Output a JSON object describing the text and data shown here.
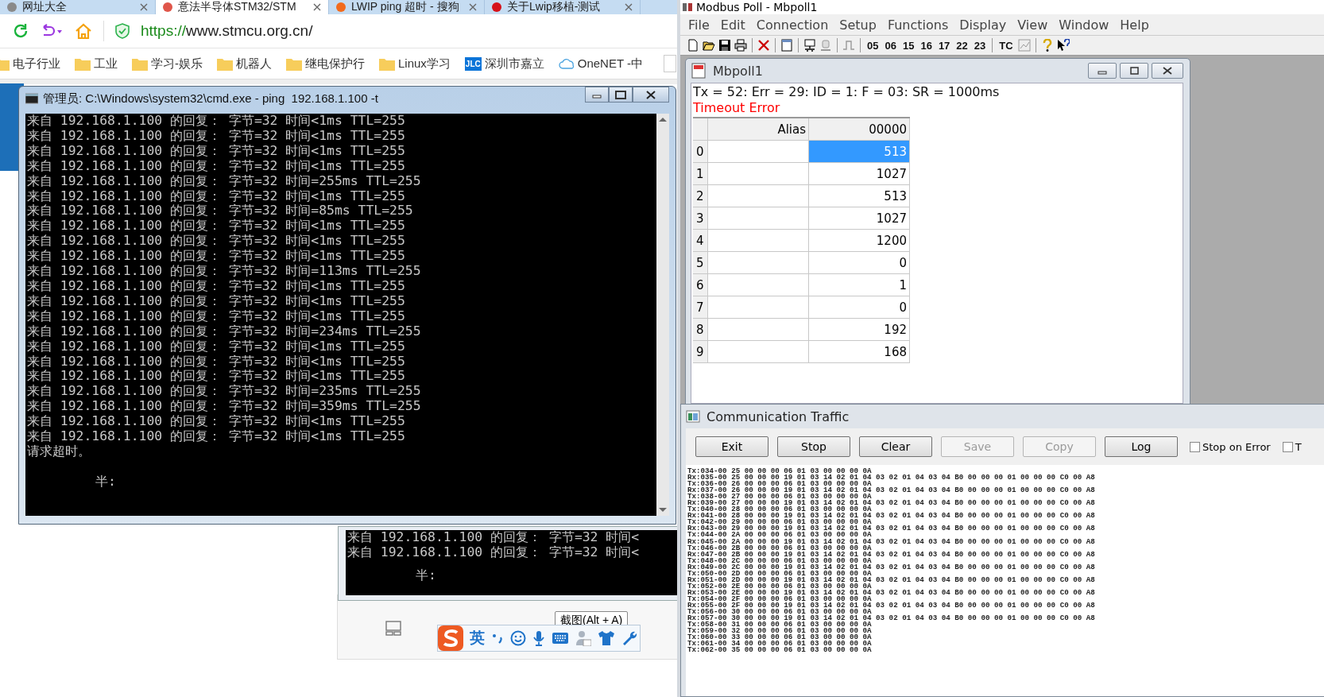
{
  "browser": {
    "tabs": [
      {
        "label": "网址大全",
        "selected": false,
        "color": "#8a8a8a"
      },
      {
        "label": "意法半导体STM32/STM",
        "selected": true,
        "color": "#e0564a"
      },
      {
        "label": "LWIP ping 超时 - 搜狗",
        "selected": false,
        "color": "#f26b1d"
      },
      {
        "label": "关于Lwip移植-测试",
        "selected": false,
        "color": "#d6121a"
      }
    ],
    "url": {
      "scheme": "https://",
      "rest": "www.stmcu.org.cn/"
    },
    "bookmarks": [
      {
        "label": "电子行业",
        "kind": "folder"
      },
      {
        "label": "工业",
        "kind": "folder"
      },
      {
        "label": "学习-娱乐",
        "kind": "folder"
      },
      {
        "label": "机器人",
        "kind": "folder"
      },
      {
        "label": "继电保护行",
        "kind": "folder"
      },
      {
        "label": "Linux学习",
        "kind": "folder"
      },
      {
        "label": "深圳市嘉立",
        "kind": "badge",
        "badge": "JLC"
      },
      {
        "label": "OneNET -中",
        "kind": "cloud"
      }
    ]
  },
  "cmd_window": {
    "title": "管理员: C:\\Windows\\system32\\cmd.exe - ping  192.168.1.100 -t",
    "lines": [
      "来自 192.168.1.100 的回复： 字节=32 时间<1ms TTL=255",
      "来自 192.168.1.100 的回复： 字节=32 时间<1ms TTL=255",
      "来自 192.168.1.100 的回复： 字节=32 时间<1ms TTL=255",
      "来自 192.168.1.100 的回复： 字节=32 时间<1ms TTL=255",
      "来自 192.168.1.100 的回复： 字节=32 时间=255ms TTL=255",
      "来自 192.168.1.100 的回复： 字节=32 时间<1ms TTL=255",
      "来自 192.168.1.100 的回复： 字节=32 时间=85ms TTL=255",
      "来自 192.168.1.100 的回复： 字节=32 时间<1ms TTL=255",
      "来自 192.168.1.100 的回复： 字节=32 时间<1ms TTL=255",
      "来自 192.168.1.100 的回复： 字节=32 时间<1ms TTL=255",
      "来自 192.168.1.100 的回复： 字节=32 时间=113ms TTL=255",
      "来自 192.168.1.100 的回复： 字节=32 时间<1ms TTL=255",
      "来自 192.168.1.100 的回复： 字节=32 时间<1ms TTL=255",
      "来自 192.168.1.100 的回复： 字节=32 时间<1ms TTL=255",
      "来自 192.168.1.100 的回复： 字节=32 时间=234ms TTL=255",
      "来自 192.168.1.100 的回复： 字节=32 时间<1ms TTL=255",
      "来自 192.168.1.100 的回复： 字节=32 时间<1ms TTL=255",
      "来自 192.168.1.100 的回复： 字节=32 时间<1ms TTL=255",
      "来自 192.168.1.100 的回复： 字节=32 时间=235ms TTL=255",
      "来自 192.168.1.100 的回复： 字节=32 时间=359ms TTL=255",
      "来自 192.168.1.100 的回复： 字节=32 时间<1ms TTL=255",
      "来自 192.168.1.100 的回复： 字节=32 时间<1ms TTL=255",
      "请求超时。"
    ],
    "prompt": "半:"
  },
  "cmd_window_2": {
    "lines": [
      "来自 192.168.1.100 的回复： 字节=32 时间<",
      "来自 192.168.1.100 的回复： 字节=32 时间<"
    ],
    "prompt": "半:"
  },
  "screenshot_button": "截图(Alt + A)",
  "ime_toolbar": {
    "mode": "英"
  },
  "modbus": {
    "title": "Modbus Poll - Mbpoll1",
    "menu": [
      "File",
      "Edit",
      "Connection",
      "Setup",
      "Functions",
      "Display",
      "View",
      "Window",
      "Help"
    ],
    "function_codes": [
      "05",
      "06",
      "15",
      "16",
      "17",
      "22",
      "23"
    ],
    "test_center": "TC",
    "poll_window": {
      "title": "Mbpoll1",
      "status": "Tx = 52: Err = 29: ID = 1: F = 03: SR = 1000ms",
      "error": "Timeout Error",
      "columns": [
        "Alias",
        "00000"
      ],
      "rows": [
        {
          "index": "0",
          "value": "513",
          "selected": true
        },
        {
          "index": "1",
          "value": "1027",
          "selected": false
        },
        {
          "index": "2",
          "value": "513",
          "selected": false
        },
        {
          "index": "3",
          "value": "1027",
          "selected": false
        },
        {
          "index": "4",
          "value": "1200",
          "selected": false
        },
        {
          "index": "5",
          "value": "0",
          "selected": false
        },
        {
          "index": "6",
          "value": "1",
          "selected": false
        },
        {
          "index": "7",
          "value": "0",
          "selected": false
        },
        {
          "index": "8",
          "value": "192",
          "selected": false
        },
        {
          "index": "9",
          "value": "168",
          "selected": false
        }
      ]
    }
  },
  "traffic": {
    "title": "Communication Traffic",
    "buttons": [
      {
        "label": "Exit",
        "disabled": false
      },
      {
        "label": "Stop",
        "disabled": false
      },
      {
        "label": "Clear",
        "disabled": false
      },
      {
        "label": "Save",
        "disabled": true
      },
      {
        "label": "Copy",
        "disabled": true
      },
      {
        "label": "Log",
        "disabled": false
      }
    ],
    "checkboxes": [
      {
        "label": "Stop on Error",
        "checked": false
      },
      {
        "label": "T",
        "checked": false
      }
    ],
    "lines": [
      "Tx:034-00 25 00 00 00 06 01 03 00 00 00 0A",
      "Rx:035-00 25 00 00 00 19 01 03 14 02 01 04 03 02 01 04 03 04 B0 00 00 00 01 00 00 00 C0 00 A8",
      "Tx:036-00 26 00 00 00 06 01 03 00 00 00 0A",
      "Rx:037-00 26 00 00 00 19 01 03 14 02 01 04 03 02 01 04 03 04 B0 00 00 00 01 00 00 00 C0 00 A8",
      "Tx:038-00 27 00 00 00 06 01 03 00 00 00 0A",
      "Rx:039-00 27 00 00 00 19 01 03 14 02 01 04 03 02 01 04 03 04 B0 00 00 00 01 00 00 00 C0 00 A8",
      "Tx:040-00 28 00 00 00 06 01 03 00 00 00 0A",
      "Rx:041-00 28 00 00 00 19 01 03 14 02 01 04 03 02 01 04 03 04 B0 00 00 00 01 00 00 00 C0 00 A8",
      "Tx:042-00 29 00 00 00 06 01 03 00 00 00 0A",
      "Rx:043-00 29 00 00 00 19 01 03 14 02 01 04 03 02 01 04 03 04 B0 00 00 00 01 00 00 00 C0 00 A8",
      "Tx:044-00 2A 00 00 00 06 01 03 00 00 00 0A",
      "Rx:045-00 2A 00 00 00 19 01 03 14 02 01 04 03 02 01 04 03 04 B0 00 00 00 01 00 00 00 C0 00 A8",
      "Tx:046-00 2B 00 00 00 06 01 03 00 00 00 0A",
      "Rx:047-00 2B 00 00 00 19 01 03 14 02 01 04 03 02 01 04 03 04 B0 00 00 00 01 00 00 00 C0 00 A8",
      "Tx:048-00 2C 00 00 00 06 01 03 00 00 00 0A",
      "Rx:049-00 2C 00 00 00 19 01 03 14 02 01 04 03 02 01 04 03 04 B0 00 00 00 01 00 00 00 C0 00 A8",
      "Tx:050-00 2D 00 00 00 06 01 03 00 00 00 0A",
      "Rx:051-00 2D 00 00 00 19 01 03 14 02 01 04 03 02 01 04 03 04 B0 00 00 00 01 00 00 00 C0 00 A8",
      "Tx:052-00 2E 00 00 00 06 01 03 00 00 00 0A",
      "Rx:053-00 2E 00 00 00 19 01 03 14 02 01 04 03 02 01 04 03 04 B0 00 00 00 01 00 00 00 C0 00 A8",
      "Tx:054-00 2F 00 00 00 06 01 03 00 00 00 0A",
      "Rx:055-00 2F 00 00 00 19 01 03 14 02 01 04 03 02 01 04 03 04 B0 00 00 00 01 00 00 00 C0 00 A8",
      "Tx:056-00 30 00 00 00 06 01 03 00 00 00 0A",
      "Rx:057-00 30 00 00 00 19 01 03 14 02 01 04 03 02 01 04 03 04 B0 00 00 00 01 00 00 00 C0 00 A8",
      "Tx:058-00 31 00 00 00 06 01 03 00 00 00 0A",
      "Tx:059-00 32 00 00 00 06 01 03 00 00 00 0A",
      "Tx:060-00 33 00 00 00 06 01 03 00 00 00 0A",
      "Tx:061-00 34 00 00 00 06 01 03 00 00 00 0A",
      "Tx:062-00 35 00 00 00 06 01 03 00 00 00 0A"
    ]
  }
}
